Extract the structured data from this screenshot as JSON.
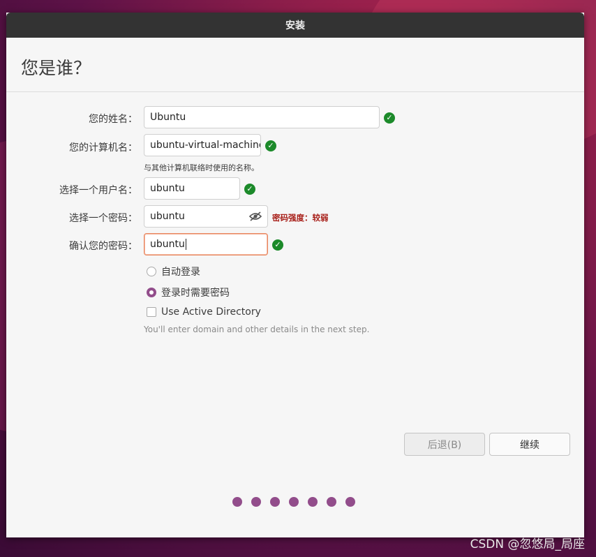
{
  "window": {
    "title": "安装"
  },
  "heading": "您是谁？",
  "form": {
    "name_label": "您的姓名：",
    "name_value": "Ubuntu",
    "computer_label": "您的计算机名：",
    "computer_value": "ubuntu-virtual-machine",
    "computer_hint": "与其他计算机联络时使用的名称。",
    "username_label": "选择一个用户名：",
    "username_value": "ubuntu",
    "password_label": "选择一个密码：",
    "password_value": "ubuntu",
    "password_strength": "密码强度：较弱",
    "confirm_label": "确认您的密码：",
    "confirm_value": "ubuntu",
    "check_mark": "✓"
  },
  "login_options": {
    "auto_login": "自动登录",
    "require_password": "登录时需要密码",
    "selected": "require_password"
  },
  "active_directory": {
    "label": "Use Active Directory",
    "hint": "You'll enter domain and other details in the next step.",
    "checked": false
  },
  "buttons": {
    "back": "后退(B)",
    "continue": "继续"
  },
  "progress": {
    "steps_total": 7,
    "steps_shown_filled": 7
  },
  "watermark": "CSDN @忽悠局_局座",
  "colors": {
    "accent": "#924d8b",
    "check": "#1c8a2a",
    "warning": "#a8201a",
    "titlebar": "#333333"
  }
}
